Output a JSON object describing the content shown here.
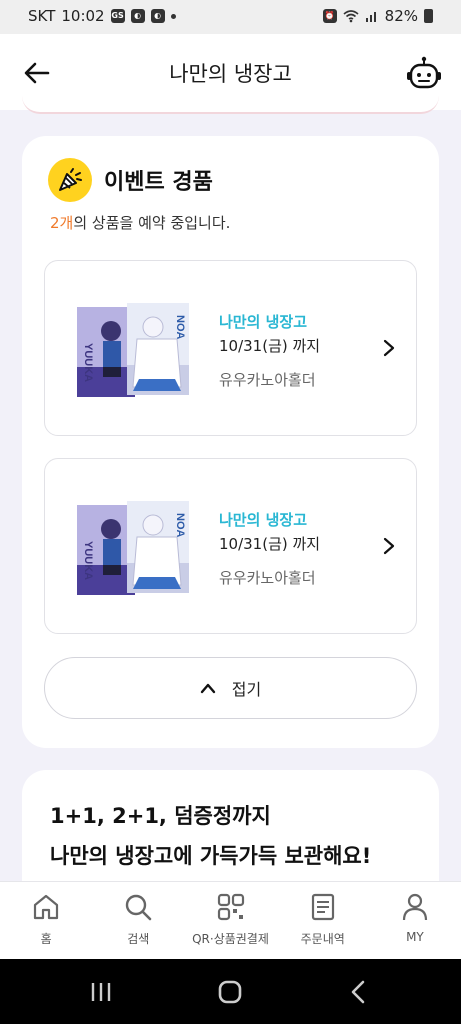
{
  "status": {
    "carrier": "SKT",
    "time": "10:02",
    "battery": "82%"
  },
  "header": {
    "title": "나만의 냉장고"
  },
  "event": {
    "title": "이벤트 경품",
    "reserve_count": "2개",
    "reserve_text": "의 상품을 예약 중입니다.",
    "items": [
      {
        "name": "나만의 냉장고",
        "date": "10/31(금) 까지",
        "desc": "유우카노아홀더"
      },
      {
        "name": "나만의 냉장고",
        "date": "10/31(금) 까지",
        "desc": "유우카노아홀더"
      }
    ],
    "fold_label": "접기"
  },
  "promo": {
    "line1": "1+1, 2+1, 덤증정까지",
    "line2": "나만의 냉장고에 가득가득 보관해요!"
  },
  "tabs": [
    {
      "label": "홈",
      "icon": "home-icon"
    },
    {
      "label": "검색",
      "icon": "search-icon"
    },
    {
      "label": "QR·상품권결제",
      "icon": "qr-icon"
    },
    {
      "label": "주문내역",
      "icon": "receipt-icon"
    },
    {
      "label": "MY",
      "icon": "person-icon"
    }
  ],
  "colors": {
    "accent_cyan": "#2ab7d3",
    "count_orange": "#f07a2b",
    "event_yellow": "#ffd21f"
  }
}
